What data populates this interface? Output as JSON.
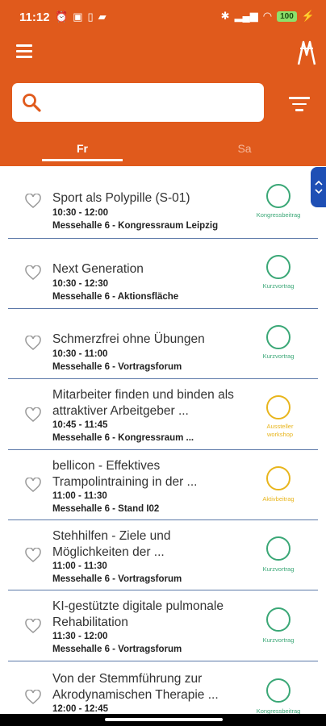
{
  "status_bar": {
    "time": "11:12",
    "left_icons": [
      "alarm-icon",
      "gallery-icon",
      "sim-icon",
      "message-icon"
    ],
    "right_icons": [
      "bluetooth-icon",
      "signal-icon",
      "wifi-icon"
    ],
    "battery": "100"
  },
  "app_bar": {
    "menu_icon": "menu-icon",
    "logo_icon": "app-logo-icon"
  },
  "search": {
    "placeholder": "",
    "value": ""
  },
  "tabs": [
    {
      "label": "Fr",
      "selected": true
    },
    {
      "label": "Sa",
      "selected": false
    }
  ],
  "colors": {
    "brand": "#e05a1c",
    "green": "#3aa776",
    "yellow": "#e8b51c",
    "separator": "#5b78a8",
    "scroll_handle": "#1e4fb5"
  },
  "sessions": [
    {
      "title": "Sport als Polypille (S-01)",
      "time": "10:30 - 12:00",
      "place": "Messehalle 6 - Kongressraum Leipzig",
      "type": "Kongressbeitrag",
      "color": "green"
    },
    {
      "title": "Next Generation",
      "time": "10:30 - 12:30",
      "place": "Messehalle 6 - Aktionsfläche",
      "type": "Kurzvortrag",
      "color": "green"
    },
    {
      "title": "Schmerzfrei ohne Übungen",
      "time": "10:30 - 11:00",
      "place": "Messehalle 6 - Vortragsforum",
      "type": "Kurzvortrag",
      "color": "green"
    },
    {
      "title": "Mitarbeiter finden und binden als attraktiver Arbeitgeber ...",
      "time": "10:45 - 11:45",
      "place": "Messehalle 6 - Kongressraum ...",
      "type": "Ausstellerworkshop",
      "color": "yellow"
    },
    {
      "title": "bellicon - Effektives Trampolintraining in der ...",
      "time": "11:00 - 11:30",
      "place": "Messehalle 6 - Stand I02",
      "type": "Aktivbeitrag",
      "color": "yellow"
    },
    {
      "title": "Stehhilfen - Ziele und Möglichkeiten der ...",
      "time": "11:00 - 11:30",
      "place": "Messehalle 6 - Vortragsforum",
      "type": "Kurzvortrag",
      "color": "green"
    },
    {
      "title": "KI-gestützte digitale pulmonale Rehabilitation",
      "time": "11:30 - 12:00",
      "place": "Messehalle 6 - Vortragsforum",
      "type": "Kurzvortrag",
      "color": "green"
    },
    {
      "title": "Von der Stemmführung zur Akrodynamischen Therapie ...",
      "time": "12:00 - 12:45",
      "place": "",
      "type": "Kongressbeitrag",
      "color": "green"
    }
  ]
}
